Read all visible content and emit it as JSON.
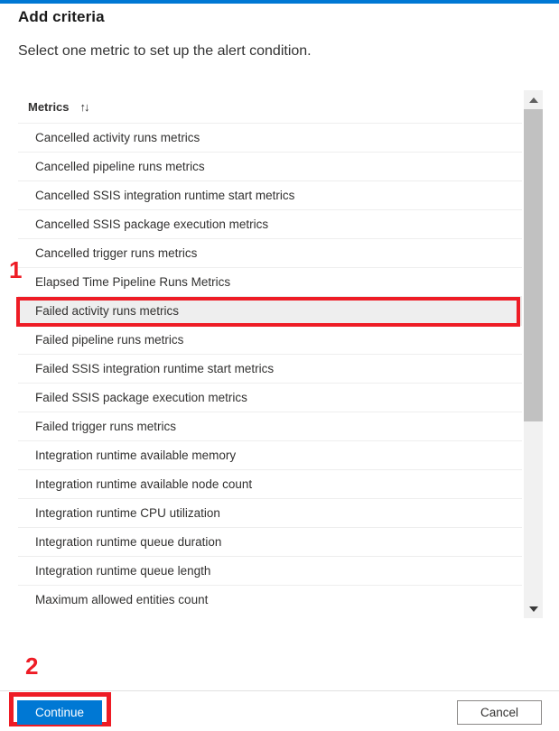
{
  "blade": {
    "title": "Add criteria",
    "subtitle": "Select one metric to set up the alert condition.",
    "accent_color": "#0078d4"
  },
  "metrics_table": {
    "column_header": "Metrics",
    "sort_icon": "sort-ascending-descending-icon",
    "sort_glyph": "↑↓",
    "selected_metric": "Failed activity runs metrics",
    "rows": [
      "Cancelled activity runs metrics",
      "Cancelled pipeline runs metrics",
      "Cancelled SSIS integration runtime start metrics",
      "Cancelled SSIS package execution metrics",
      "Cancelled trigger runs metrics",
      "Elapsed Time Pipeline Runs Metrics",
      "Failed activity runs metrics",
      "Failed pipeline runs metrics",
      "Failed SSIS integration runtime start metrics",
      "Failed SSIS package execution metrics",
      "Failed trigger runs metrics",
      "Integration runtime available memory",
      "Integration runtime available node count",
      "Integration runtime CPU utilization",
      "Integration runtime queue duration",
      "Integration runtime queue length",
      "Maximum allowed entities count"
    ]
  },
  "scrollbar": {
    "up_arrow_icon": "chevron-up-icon",
    "down_arrow_icon": "chevron-down-icon",
    "thumb_color": "#c1c1c1",
    "track_color": "#f1f1f1"
  },
  "footer": {
    "continue_label": "Continue",
    "cancel_label": "Cancel",
    "primary_color": "#0078d4"
  },
  "annotations": {
    "step_one": "1",
    "step_two": "2",
    "highlight_color": "#ee1c25"
  }
}
